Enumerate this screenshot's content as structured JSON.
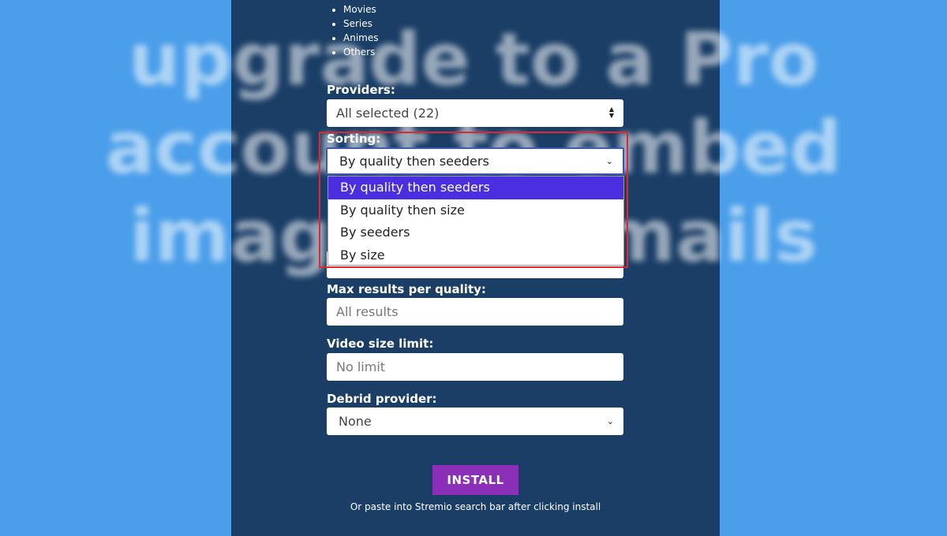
{
  "watermark": {
    "text": "upgrade to a Pro\naccount to embed\nimages in emails"
  },
  "catalog": {
    "items": [
      "Movies",
      "Series",
      "Animes",
      "Others"
    ]
  },
  "providers": {
    "label": "Providers:",
    "value": "All selected (22)"
  },
  "sorting": {
    "label": "Sorting:",
    "value": "By quality then seeders",
    "options": [
      "By quality then seeders",
      "By quality then size",
      "By seeders",
      "By size"
    ],
    "selected_index": 0
  },
  "max_results": {
    "label": "Max results per quality:",
    "placeholder": "All results"
  },
  "size_limit": {
    "label": "Video size limit:",
    "placeholder": "No limit"
  },
  "debrid": {
    "label": "Debrid provider:",
    "value": "None"
  },
  "install": {
    "label": "INSTALL",
    "hint": "Or paste into Stremio search bar after clicking install"
  },
  "colors": {
    "page_bg": "#4a9eea",
    "panel_bg": "#1a3e66",
    "selected_option": "#4b2ee0",
    "install_button": "#8b2fb8",
    "highlight_border": "#e0262e"
  }
}
